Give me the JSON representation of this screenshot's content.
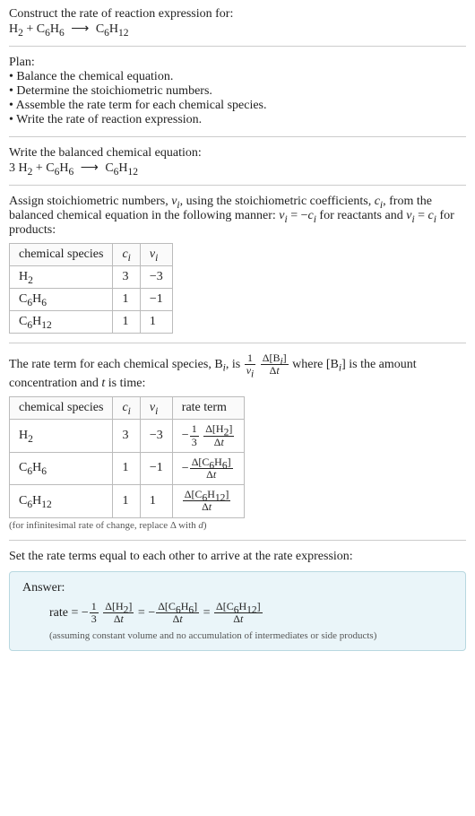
{
  "construct": {
    "title": "Construct the rate of reaction expression for:",
    "equation_html": "H<span class='sub'>2</span> + C<span class='sub'>6</span>H<span class='sub'>6</span> <span class='arrow'>⟶</span> C<span class='sub'>6</span>H<span class='sub'>12</span>"
  },
  "plan": {
    "title": "Plan:",
    "items": [
      "• Balance the chemical equation.",
      "• Determine the stoichiometric numbers.",
      "• Assemble the rate term for each chemical species.",
      "• Write the rate of reaction expression."
    ]
  },
  "balance": {
    "title": "Write the balanced chemical equation:",
    "equation_html": "3 H<span class='sub'>2</span> + C<span class='sub'>6</span>H<span class='sub'>6</span> <span class='arrow'>⟶</span> C<span class='sub'>6</span>H<span class='sub'>12</span>"
  },
  "stoich": {
    "intro_html": "Assign stoichiometric numbers, <span class='italic'>ν<span class='sub'>i</span></span>, using the stoichiometric coefficients, <span class='italic'>c<span class='sub'>i</span></span>, from the balanced chemical equation in the following manner: <span class='italic'>ν<span class='sub'>i</span></span> = −<span class='italic'>c<span class='sub'>i</span></span> for reactants and <span class='italic'>ν<span class='sub'>i</span></span> = <span class='italic'>c<span class='sub'>i</span></span> for products:",
    "headers": {
      "species": "chemical species",
      "ci_html": "<span class='italic'>c<span class='sub'>i</span></span>",
      "vi_html": "<span class='italic'>ν<span class='sub'>i</span></span>"
    },
    "rows": [
      {
        "species_html": "H<span class='sub'>2</span>",
        "ci": "3",
        "vi": "−3"
      },
      {
        "species_html": "C<span class='sub'>6</span>H<span class='sub'>6</span>",
        "ci": "1",
        "vi": "−1"
      },
      {
        "species_html": "C<span class='sub'>6</span>H<span class='sub'>12</span>",
        "ci": "1",
        "vi": "1"
      }
    ]
  },
  "rateterm": {
    "intro_prefix": "The rate term for each chemical species, B",
    "intro_mid1": ", is ",
    "intro_mid2": " where [B",
    "intro_mid3": "] is the amount concentration and ",
    "intro_t": "t",
    "intro_suffix": " is time:",
    "headers": {
      "species": "chemical species",
      "ci_html": "<span class='italic'>c<span class='sub'>i</span></span>",
      "vi_html": "<span class='italic'>ν<span class='sub'>i</span></span>",
      "rate": "rate term"
    },
    "rows": [
      {
        "species_html": "H<span class='sub'>2</span>",
        "ci": "3",
        "vi": "−3",
        "rate_html": "−<span class='frac'><span class='num'>1</span><span class='den'>3</span></span> <span class='frac'><span class='num'>Δ[H<span class='sub'>2</span>]</span><span class='den'>Δ<span class='italic'>t</span></span></span>"
      },
      {
        "species_html": "C<span class='sub'>6</span>H<span class='sub'>6</span>",
        "ci": "1",
        "vi": "−1",
        "rate_html": "−<span class='frac'><span class='num'>Δ[C<span class='sub'>6</span>H<span class='sub'>6</span>]</span><span class='den'>Δ<span class='italic'>t</span></span></span>"
      },
      {
        "species_html": "C<span class='sub'>6</span>H<span class='sub'>12</span>",
        "ci": "1",
        "vi": "1",
        "rate_html": "<span class='frac'><span class='num'>Δ[C<span class='sub'>6</span>H<span class='sub'>12</span>]</span><span class='den'>Δ<span class='italic'>t</span></span></span>"
      }
    ],
    "note_html": "(for infinitesimal rate of change, replace Δ with <span class='italic'>d</span>)"
  },
  "setequal": {
    "title": "Set the rate terms equal to each other to arrive at the rate expression:"
  },
  "answer": {
    "label": "Answer:",
    "rate_html": "rate = −<span class='frac'><span class='num'>1</span><span class='den'>3</span></span> <span class='frac'><span class='num'>Δ[H<span class='sub'>2</span>]</span><span class='den'>Δ<span class='italic'>t</span></span></span> = −<span class='frac'><span class='num'>Δ[C<span class='sub'>6</span>H<span class='sub'>6</span>]</span><span class='den'>Δ<span class='italic'>t</span></span></span> = <span class='frac'><span class='num'>Δ[C<span class='sub'>6</span>H<span class='sub'>12</span>]</span><span class='den'>Δ<span class='italic'>t</span></span></span>",
    "note": "(assuming constant volume and no accumulation of intermediates or side products)"
  }
}
